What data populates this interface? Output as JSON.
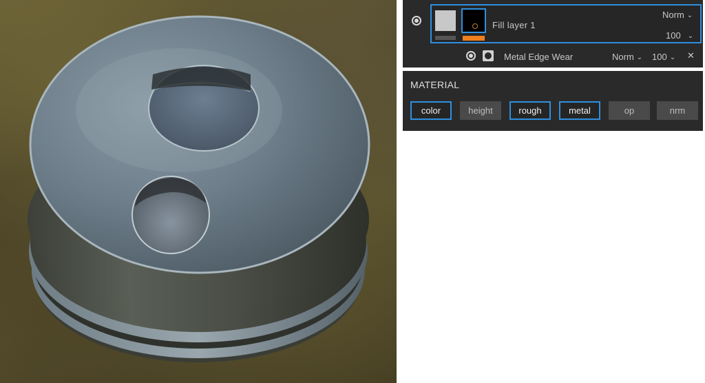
{
  "viewport": {
    "object": "metal disc with two circular holes",
    "background": "blurred grass environment"
  },
  "layers": {
    "fill_layer": {
      "name": "Fill layer 1",
      "blend_mode": "Norm",
      "opacity": "100",
      "visible": true,
      "selected": true,
      "mask_indicator_color": "#f07f1e"
    },
    "effect": {
      "name": "Metal Edge Wear",
      "blend_mode": "Norm",
      "opacity": "100",
      "visible": true
    }
  },
  "material": {
    "title": "MATERIAL",
    "channels": [
      {
        "label": "color",
        "active": true
      },
      {
        "label": "height",
        "active": false
      },
      {
        "label": "rough",
        "active": true
      },
      {
        "label": "metal",
        "active": true
      },
      {
        "label": "op",
        "active": false
      },
      {
        "label": "nrm",
        "active": false
      }
    ]
  },
  "colors": {
    "accent": "#2f8fe0",
    "panel_bg": "#2a2a2a",
    "chip_off": "#4a4a4a"
  }
}
